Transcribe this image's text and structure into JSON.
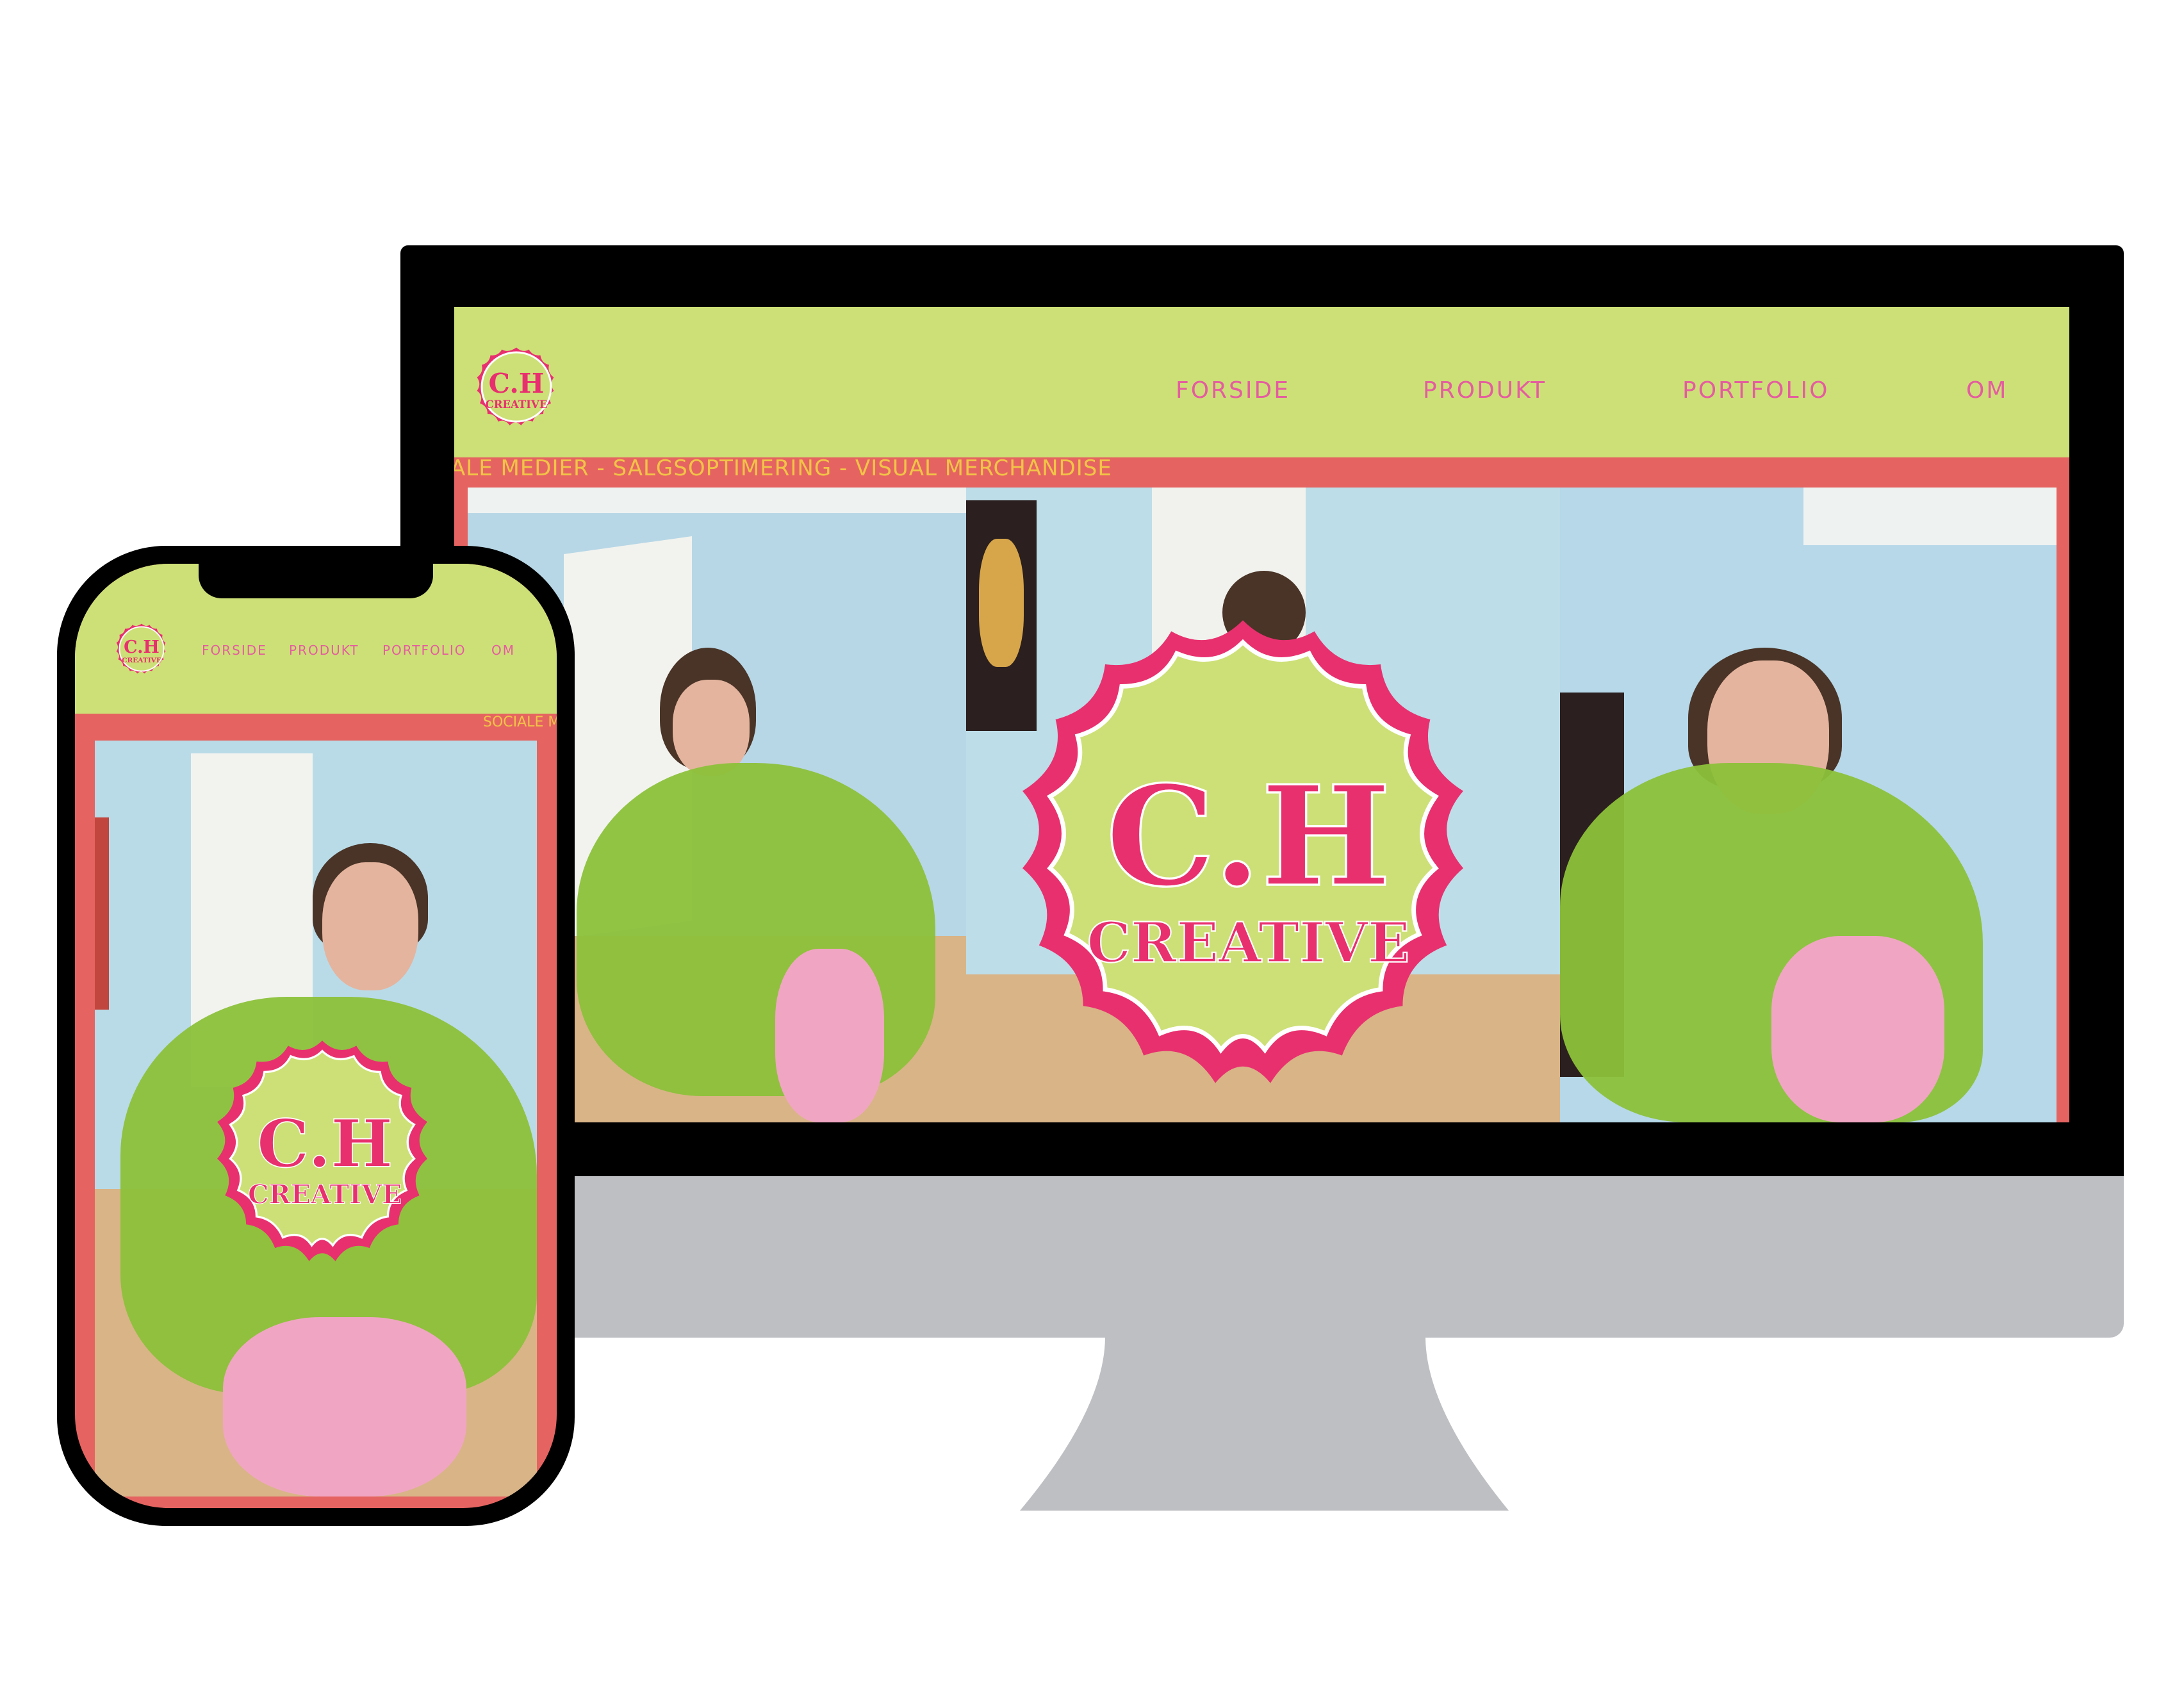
{
  "brand": {
    "logo_main": "C.H",
    "logo_sub": "CREATIVE"
  },
  "desktop": {
    "nav": [
      "FORSIDE",
      "PRODUKT",
      "PORTFOLIO",
      "OM"
    ],
    "ticker": "ALE MEDIER - SALGSOPTIMERING - VISUAL MERCHANDISE"
  },
  "mobile": {
    "nav": [
      "FORSIDE",
      "PRODUKT",
      "PORTFOLIO",
      "OM"
    ],
    "ticker": "SOCIALE M"
  },
  "colors": {
    "lime": "#cde077",
    "coral": "#e56461",
    "pink_text": "#e55ca0",
    "ticker_yellow": "#f1c447",
    "logo_red": "#e8306f",
    "dress_green": "#8cc13a",
    "wall_blue": "#b9dbe8",
    "monitor_gray": "#bebfc3"
  },
  "icons": [
    "ch-creative-logo",
    "hero-logo-badge"
  ]
}
